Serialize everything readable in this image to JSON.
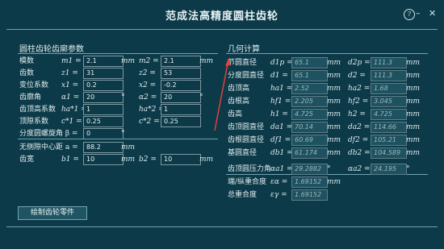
{
  "app": {
    "title": "范成法高精度圆柱齿轮"
  },
  "window_buttons": {
    "help": "?",
    "minimize": "–",
    "close": "✕"
  },
  "left": {
    "section_title": "圆柱齿轮齿廓参数",
    "rows": [
      {
        "label": "模数",
        "sym1": "m1 =",
        "v1": "2.1",
        "u1": "mm",
        "sym2": "m2 =",
        "v2": "2.1",
        "u2": "mm"
      },
      {
        "label": "齿数",
        "sym1": "z1 =",
        "v1": "31",
        "u1": "",
        "sym2": "z2 =",
        "v2": "53",
        "u2": ""
      },
      {
        "label": "变位系数",
        "sym1": "x1 =",
        "v1": "0.2",
        "u1": "",
        "sym2": "x2 =",
        "v2": "-0.2",
        "u2": ""
      },
      {
        "label": "齿廓角",
        "sym1": "α1 =",
        "v1": "20",
        "u1": "°",
        "sym2": "α2 =",
        "v2": "20",
        "u2": "°"
      },
      {
        "label": "齿顶高系数",
        "sym1": "ha*1 =",
        "v1": "1",
        "u1": "",
        "sym2": "ha*2 =",
        "v2": "1",
        "u2": ""
      },
      {
        "label": "顶隙系数",
        "sym1": "c*1 =",
        "v1": "0.25",
        "u1": "",
        "sym2": "c*2 =",
        "v2": "0.25",
        "u2": ""
      },
      {
        "label": "分度圆螺旋角 β =",
        "sym1": "",
        "v1": "0",
        "u1": "°",
        "sym2": "",
        "v2": "",
        "u2": ""
      }
    ],
    "center": {
      "label": "无侧隙中心距 a =",
      "value": "88.2",
      "unit": "mm"
    },
    "width": {
      "label": "齿宽",
      "sym1": "b1 =",
      "v1": "10",
      "u1": "mm",
      "sym2": "b2 =",
      "v2": "10",
      "u2": "mm"
    },
    "draw_button": "绘制齿轮零件"
  },
  "right": {
    "section_title": "几何计算",
    "rows": [
      {
        "label": "节圆直径",
        "sym1": "d1p =",
        "v1": "65.1",
        "u1": "mm",
        "sym2": "d2p =",
        "v2": "111.3",
        "u2": "mm"
      },
      {
        "label": "分度圆直径",
        "sym1": "d1 =",
        "v1": "65.1",
        "u1": "mm",
        "sym2": "d2 =",
        "v2": "111.3",
        "u2": "mm"
      },
      {
        "label": "齿顶高",
        "sym1": "ha1 =",
        "v1": "2.52",
        "u1": "mm",
        "sym2": "ha2 =",
        "v2": "1.68",
        "u2": "mm"
      },
      {
        "label": "齿根高",
        "sym1": "hf1 =",
        "v1": "2.205",
        "u1": "mm",
        "sym2": "hf2 =",
        "v2": "3.045",
        "u2": "mm"
      },
      {
        "label": "齿高",
        "sym1": "h1 =",
        "v1": "4.725",
        "u1": "mm",
        "sym2": "h2 =",
        "v2": "4.725",
        "u2": "mm"
      },
      {
        "label": "齿顶圆直径",
        "sym1": "da1 =",
        "v1": "70.14",
        "u1": "mm",
        "sym2": "da2 =",
        "v2": "114.66",
        "u2": "mm"
      },
      {
        "label": "齿根圆直径",
        "sym1": "df1 =",
        "v1": "60.69",
        "u1": "mm",
        "sym2": "df2 =",
        "v2": "105.21",
        "u2": "mm"
      },
      {
        "label": "基圆直径",
        "sym1": "db1 =",
        "v1": "61.174",
        "u1": "mm",
        "sym2": "db2 =",
        "v2": "104.589",
        "u2": "mm"
      },
      {
        "label": "齿顶圆压力角",
        "sym1": "αa1 =",
        "v1": "29.2882",
        "u1": "°",
        "sym2": "αa2 =",
        "v2": "24.195",
        "u2": "°"
      },
      {
        "label": "端/纵重合度",
        "sym1": "εα =",
        "v1": "1.69152",
        "u1": "mm",
        "sym2": "",
        "v2": "",
        "u2": ""
      },
      {
        "label": "总重合度",
        "sym1": "εγ =",
        "v1": "1.69152",
        "u1": "",
        "sym2": "",
        "v2": "",
        "u2": ""
      }
    ]
  },
  "colors": {
    "background": "#0c3a48",
    "readonly_field": "#1e5260",
    "divider": "#6fa3b2",
    "annotation_arrow": "#e0413a"
  }
}
